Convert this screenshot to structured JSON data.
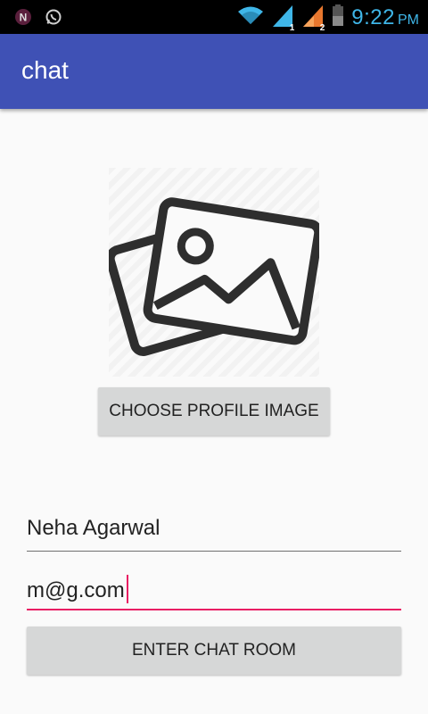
{
  "status_bar": {
    "time": "9:22",
    "ampm": "PM",
    "sim1": "1",
    "sim2": "2",
    "icons": [
      "n-app-icon",
      "whatsapp-icon",
      "wifi-icon",
      "signal-sim1-icon",
      "signal-sim2-icon",
      "battery-icon"
    ],
    "accent": "#3fb6e8"
  },
  "app_bar": {
    "title": "chat",
    "color": "#3f51b5"
  },
  "profile": {
    "image_icon": "image-placeholder-icon",
    "choose_label": "CHOOSE PROFILE IMAGE"
  },
  "form": {
    "name_value": "Neha Agarwal",
    "email_value": "m@g.com",
    "focus_color": "#e91e63"
  },
  "actions": {
    "enter_label": "ENTER CHAT ROOM"
  }
}
